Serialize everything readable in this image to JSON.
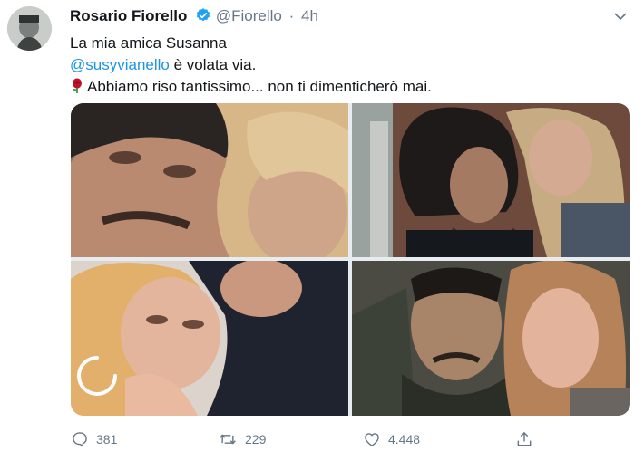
{
  "tweet": {
    "author_name": "Rosario Fiorello",
    "handle": "@Fiorello",
    "separator": "·",
    "time": "4h",
    "lines": {
      "line1": "La mia amica Susanna",
      "mention": "@susyvianello",
      "line2_rest": " è volata via.",
      "line3": "Abbiamo riso tantissimo... non ti dimenticherò mai."
    }
  },
  "actions": {
    "replies": "381",
    "retweets": "229",
    "likes": "4.448"
  },
  "colors": {
    "accent": "#1b95e0",
    "secondary_text": "#657786",
    "verified": "#1da1f2",
    "rose": "#c0102a"
  },
  "icons": [
    "verified-badge-icon",
    "chevron-down-icon",
    "rose-icon",
    "reply-icon",
    "retweet-icon",
    "like-icon",
    "share-icon",
    "loading-spinner-icon"
  ]
}
